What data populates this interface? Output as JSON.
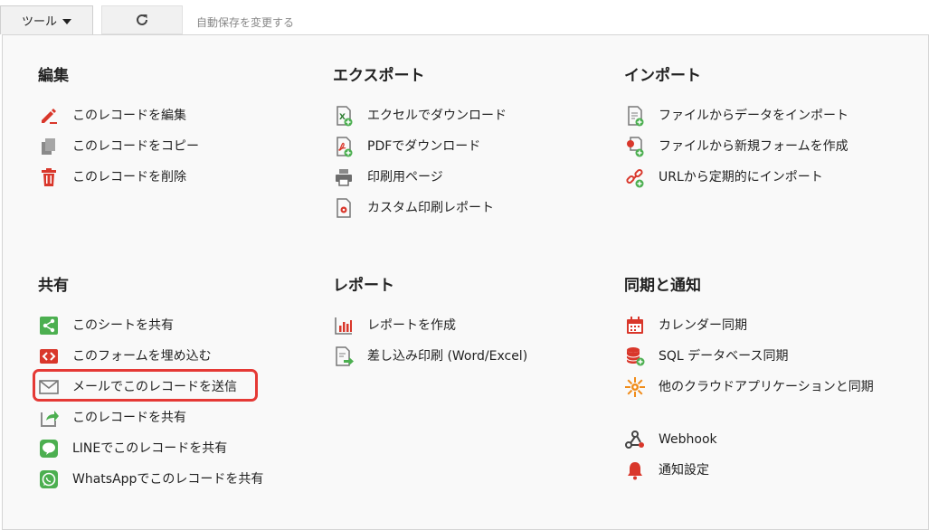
{
  "toolbar": {
    "tools_label": "ツール",
    "autosave_label": "自動保存を変更する"
  },
  "sections": {
    "edit": {
      "title": "編集",
      "items": [
        "このレコードを編集",
        "このレコードをコピー",
        "このレコードを削除"
      ]
    },
    "export": {
      "title": "エクスポート",
      "items": [
        "エクセルでダウンロード",
        "PDFでダウンロード",
        "印刷用ページ",
        "カスタム印刷レポート"
      ]
    },
    "import": {
      "title": "インポート",
      "items": [
        "ファイルからデータをインポート",
        "ファイルから新規フォームを作成",
        "URLから定期的にインポート"
      ]
    },
    "share": {
      "title": "共有",
      "items": [
        "このシートを共有",
        "このフォームを埋め込む",
        "メールでこのレコードを送信",
        "このレコードを共有",
        "LINEでこのレコードを共有",
        "WhatsAppでこのレコードを共有"
      ]
    },
    "report": {
      "title": "レポート",
      "items": [
        "レポートを作成",
        "差し込み印刷 (Word/Excel)"
      ]
    },
    "sync": {
      "title": "同期と通知",
      "items": [
        "カレンダー同期",
        "SQL データベース同期",
        "他のクラウドアプリケーションと同期",
        "Webhook",
        "通知設定"
      ]
    }
  },
  "icons": {
    "edit": [
      "pencil-icon",
      "copy-icon",
      "trash-icon"
    ],
    "export": [
      "excel-file-icon",
      "pdf-file-icon",
      "printer-icon",
      "custom-print-icon"
    ],
    "import": [
      "file-import-icon",
      "new-form-from-file-icon",
      "url-import-icon"
    ],
    "share": [
      "share-icon",
      "embed-code-icon",
      "mail-icon",
      "share-record-icon",
      "line-icon",
      "whatsapp-icon"
    ],
    "report": [
      "bar-chart-icon",
      "mail-merge-icon"
    ],
    "sync": [
      "calendar-icon",
      "database-icon",
      "cloud-app-icon",
      "webhook-icon",
      "bell-icon"
    ]
  },
  "colors": {
    "red_icon": "#d9372b",
    "gray_icon": "#8a8a8a",
    "green_icon": "#4caf50",
    "orange_icon": "#f08c1a",
    "highlight_border": "#e53935",
    "panel_bg": "#f9f9f9"
  }
}
